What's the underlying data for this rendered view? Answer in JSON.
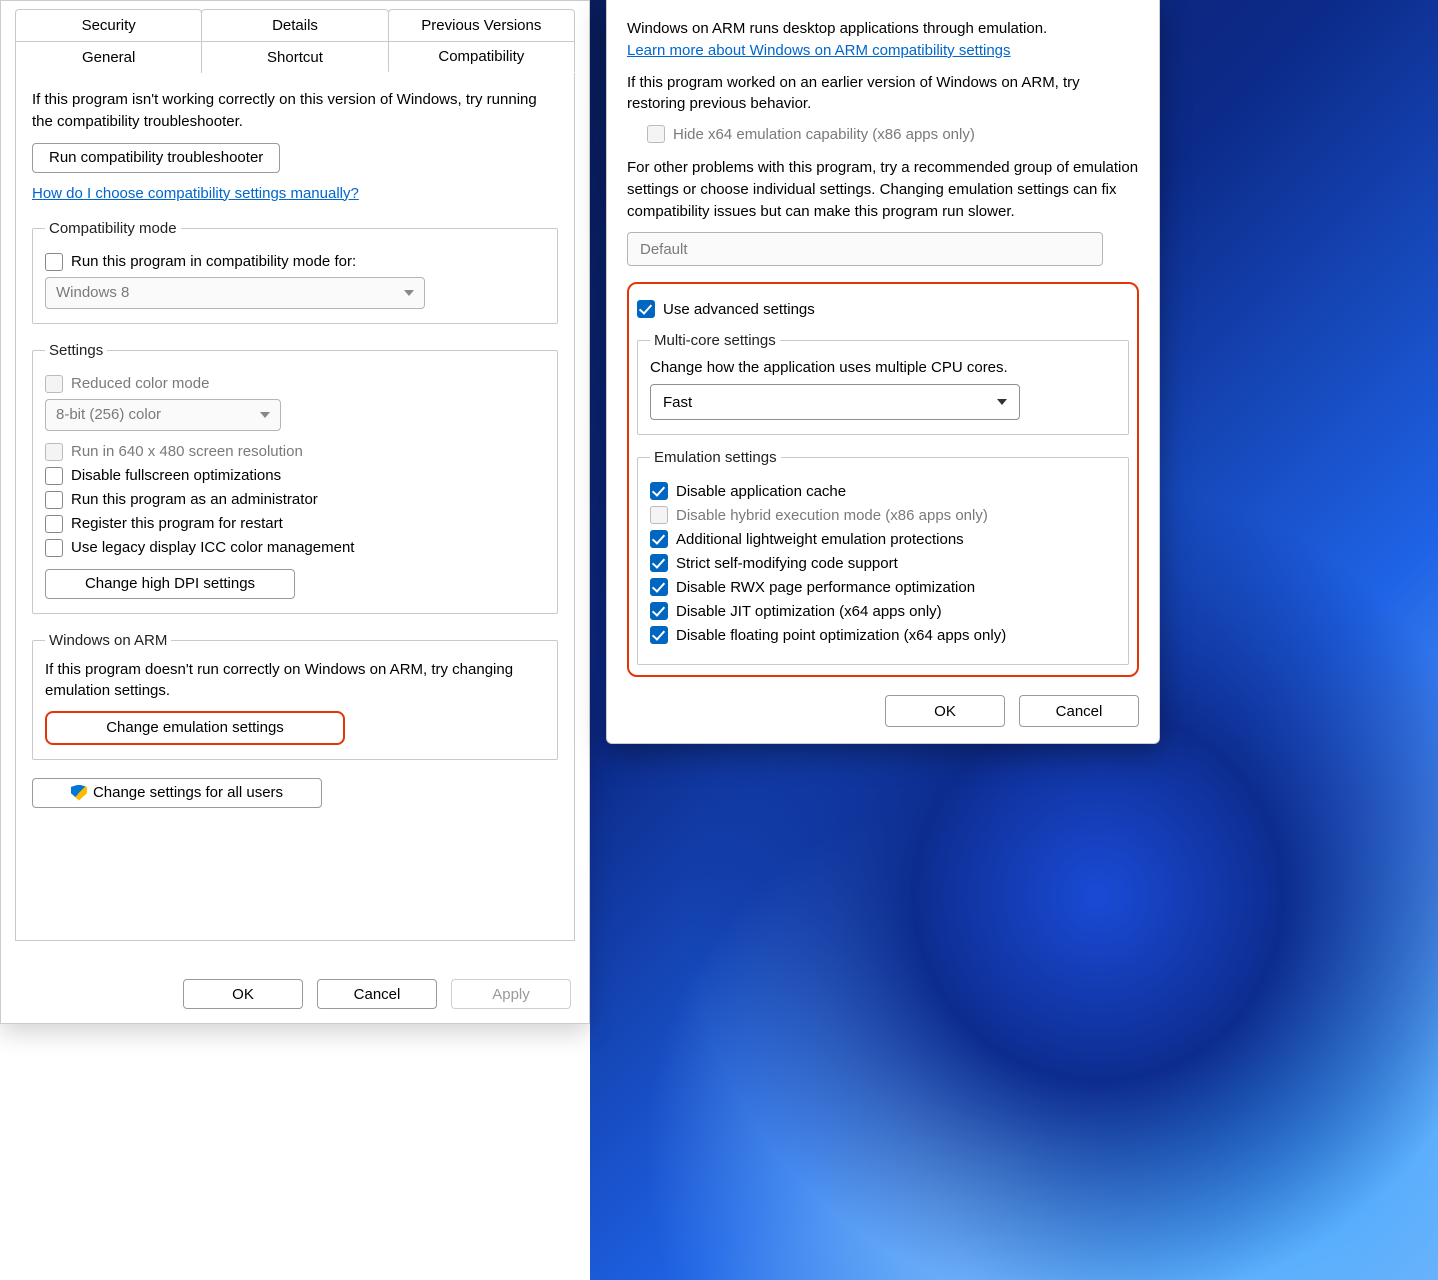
{
  "left": {
    "tabs_row1": [
      "Security",
      "Details",
      "Previous Versions"
    ],
    "tabs_row2": [
      "General",
      "Shortcut",
      "Compatibility"
    ],
    "active_tab": "Compatibility",
    "intro": "If this program isn't working correctly on this version of Windows, try running the compatibility troubleshooter.",
    "run_troubleshooter_btn": "Run compatibility troubleshooter",
    "help_link": "How do I choose compatibility settings manually?",
    "compat_mode": {
      "legend": "Compatibility mode",
      "checkbox_label": "Run this program in compatibility mode for:",
      "select_value": "Windows 8"
    },
    "settings": {
      "legend": "Settings",
      "reduced_color_label": "Reduced color mode",
      "color_depth_value": "8-bit (256) color",
      "run_640_label": "Run in 640 x 480 screen resolution",
      "disable_fullscreen_label": "Disable fullscreen optimizations",
      "run_admin_label": "Run this program as an administrator",
      "register_restart_label": "Register this program for restart",
      "legacy_icc_label": "Use legacy display ICC color management",
      "high_dpi_btn": "Change high DPI settings"
    },
    "arm": {
      "legend": "Windows on ARM",
      "text": "If this program doesn't run correctly on Windows on ARM, try changing emulation settings.",
      "change_emulation_btn": "Change emulation settings"
    },
    "all_users_btn": "Change settings for all users",
    "ok": "OK",
    "cancel": "Cancel",
    "apply": "Apply"
  },
  "right": {
    "p1": "Windows on ARM runs desktop applications through emulation.",
    "learn_link": "Learn more about Windows on ARM compatibility settings",
    "p2": "If this program worked on an earlier version of Windows on ARM, try restoring previous behavior.",
    "hide_x64_label": "Hide x64 emulation capability (x86 apps only)",
    "p3": "For other problems with this program, try a recommended group of emulation settings or choose individual settings.  Changing emulation settings can fix compatibility issues but can make this program run slower.",
    "preset_value": "Default",
    "advanced_checkbox": "Use advanced settings",
    "multicore": {
      "legend": "Multi-core settings",
      "text": "Change how the application uses multiple CPU cores.",
      "value": "Fast"
    },
    "emulation": {
      "legend": "Emulation settings",
      "items": [
        {
          "label": "Disable application cache",
          "checked": true,
          "inactive": false
        },
        {
          "label": "Disable hybrid execution mode (x86 apps only)",
          "checked": false,
          "inactive": true
        },
        {
          "label": "Additional lightweight emulation protections",
          "checked": true,
          "inactive": false
        },
        {
          "label": "Strict self-modifying code support",
          "checked": true,
          "inactive": false
        },
        {
          "label": "Disable RWX page performance optimization",
          "checked": true,
          "inactive": false
        },
        {
          "label": "Disable JIT optimization (x64 apps only)",
          "checked": true,
          "inactive": false
        },
        {
          "label": "Disable floating point optimization (x64 apps only)",
          "checked": true,
          "inactive": false
        }
      ]
    },
    "ok": "OK",
    "cancel": "Cancel"
  }
}
